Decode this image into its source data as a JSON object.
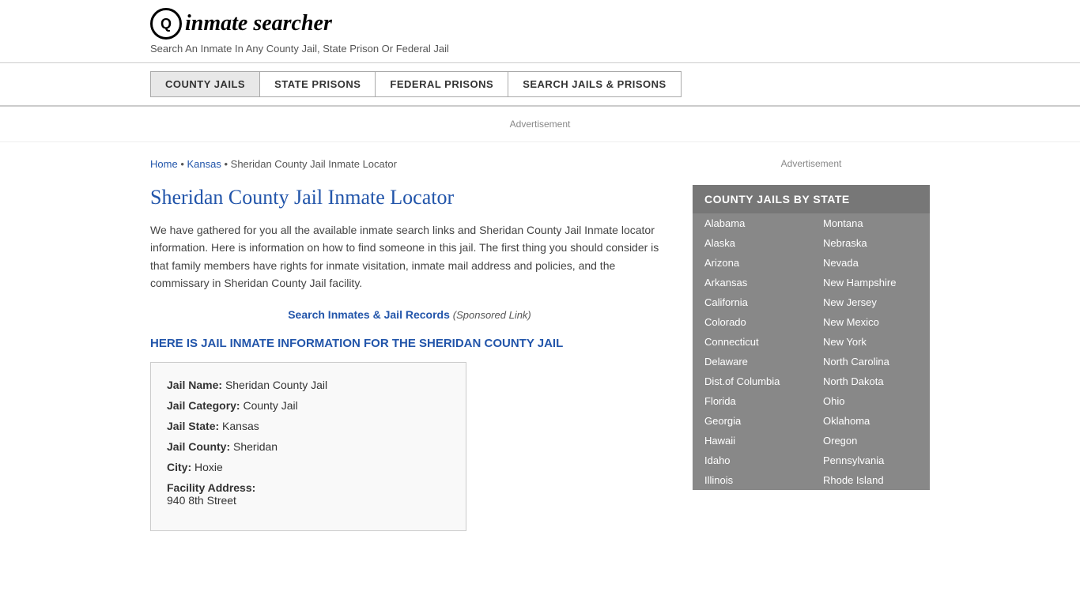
{
  "header": {
    "logo_icon": "🔍",
    "logo_text": "inmate searcher",
    "tagline": "Search An Inmate In Any County Jail, State Prison Or Federal Jail"
  },
  "nav": {
    "items": [
      {
        "label": "COUNTY JAILS",
        "active": true
      },
      {
        "label": "STATE PRISONS",
        "active": false
      },
      {
        "label": "FEDERAL PRISONS",
        "active": false
      },
      {
        "label": "SEARCH JAILS & PRISONS",
        "active": false
      }
    ]
  },
  "ad_label": "Advertisement",
  "breadcrumb": {
    "home": "Home",
    "state": "Kansas",
    "current": "Sheridan County Jail Inmate Locator"
  },
  "page_title": "Sheridan County Jail Inmate Locator",
  "description": "We have gathered for you all the available inmate search links and Sheridan County Jail Inmate locator information. Here is information on how to find someone in this jail. The first thing you should consider is that family members have rights for inmate visitation, inmate mail address and policies, and the commissary in Sheridan County Jail facility.",
  "sponsored": {
    "link_text": "Search Inmates & Jail Records",
    "label": "(Sponsored Link)"
  },
  "jail_heading": "HERE IS JAIL INMATE INFORMATION FOR THE SHERIDAN COUNTY JAIL",
  "jail_info": {
    "name_label": "Jail Name:",
    "name_value": "Sheridan County Jail",
    "category_label": "Jail Category:",
    "category_value": "County Jail",
    "state_label": "Jail State:",
    "state_value": "Kansas",
    "county_label": "Jail County:",
    "county_value": "Sheridan",
    "city_label": "City:",
    "city_value": "Hoxie",
    "address_label": "Facility Address:",
    "address_value": "940 8th Street"
  },
  "sidebar": {
    "ad_label": "Advertisement",
    "section_title": "COUNTY JAILS BY STATE",
    "states_col1": [
      "Alabama",
      "Alaska",
      "Arizona",
      "Arkansas",
      "California",
      "Colorado",
      "Connecticut",
      "Delaware",
      "Dist.of Columbia",
      "Florida",
      "Georgia",
      "Hawaii",
      "Idaho",
      "Illinois"
    ],
    "states_col2": [
      "Montana",
      "Nebraska",
      "Nevada",
      "New Hampshire",
      "New Jersey",
      "New Mexico",
      "New York",
      "North Carolina",
      "North Dakota",
      "Ohio",
      "Oklahoma",
      "Oregon",
      "Pennsylvania",
      "Rhode Island"
    ]
  }
}
